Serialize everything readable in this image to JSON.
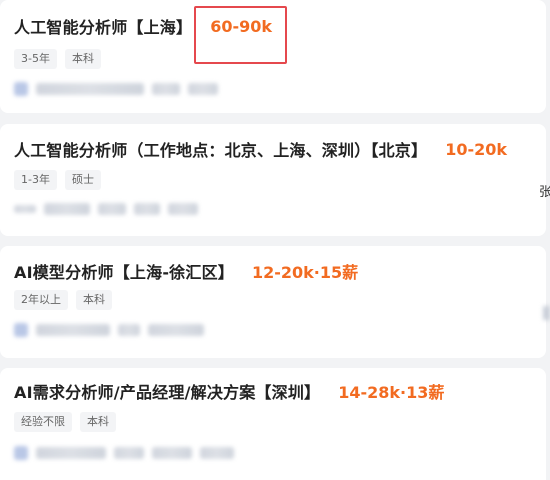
{
  "jobs": [
    {
      "title": "人工智能分析师【上海】",
      "salary": "60-90k",
      "tags": [
        "3-5年",
        "本科"
      ]
    },
    {
      "title": "人工智能分析师（工作地点：北京、上海、深圳）【北京】",
      "salary": "10-20k",
      "tags": [
        "1-3年",
        "硕士"
      ]
    },
    {
      "title": "AI模型分析师【上海-徐汇区】",
      "salary": "12-20k·15薪",
      "tags": [
        "2年以上",
        "本科"
      ]
    },
    {
      "title": "AI需求分析师/产品经理/解决方案【深圳】",
      "salary": "14-28k·13薪",
      "tags": [
        "经验不限",
        "本科"
      ]
    }
  ],
  "edge_text": "张",
  "colors": {
    "salary": "#f26b21",
    "highlight": "#e5484d",
    "title": "#222222"
  }
}
